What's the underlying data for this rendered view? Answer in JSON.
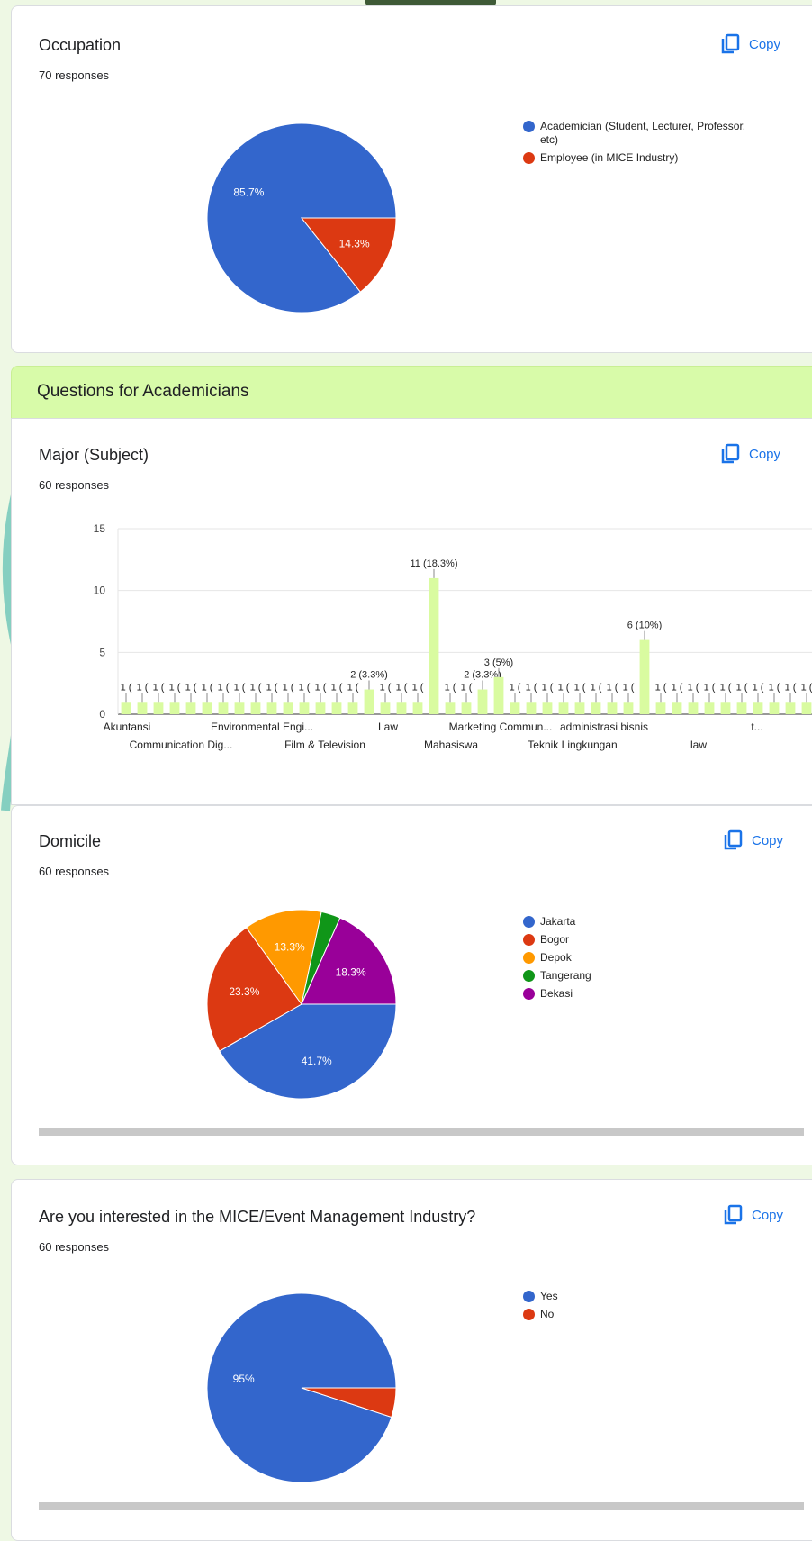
{
  "colors": {
    "blue": "#3366cc",
    "red": "#dc3912",
    "orange": "#ff9900",
    "green": "#109618",
    "purple": "#990099",
    "bar": "#d9fba0",
    "accent_link": "#1a73e8",
    "section_bg": "#d8fba9"
  },
  "copy_label": "Copy",
  "section": {
    "title": "Questions for Academicians"
  },
  "cards": {
    "occupation": {
      "title": "Occupation",
      "responses": "70 responses",
      "legend": [
        "Academician (Student, Lecturer, Professor, etc)",
        "Employee (in MICE Industry)"
      ]
    },
    "major": {
      "title": "Major (Subject)",
      "responses": "60 responses"
    },
    "domicile": {
      "title": "Domicile",
      "responses": "60 responses",
      "legend": [
        "Jakarta",
        "Bogor",
        "Depok",
        "Tangerang",
        "Bekasi"
      ]
    },
    "interest": {
      "title": "Are you interested in the MICE/Event Management Industry?",
      "responses": "60 responses",
      "legend": [
        "Yes",
        "No"
      ]
    }
  },
  "chart_data": [
    {
      "type": "pie",
      "categories": [
        "Academician (Student, Lecturer, Professor, etc)",
        "Employee (in MICE Industry)"
      ],
      "values": [
        85.7,
        14.3
      ],
      "labels": [
        "85.7%",
        "14.3%"
      ],
      "colors": [
        "#3366cc",
        "#dc3912"
      ],
      "legend_position": "right"
    },
    {
      "type": "bar",
      "ylim": [
        0,
        15
      ],
      "yticks": [
        0,
        5,
        10,
        15
      ],
      "x_tick_labels_row1": [
        "Akuntansi",
        "Environmental Engi...",
        "Law",
        "Marketing Commun...",
        "administrasi bisnis",
        "t..."
      ],
      "x_tick_labels_row2": [
        "Communication Dig...",
        "Film & Television",
        "Mahasiswa",
        "Teknik Lingkungan",
        "law"
      ],
      "values": [
        1,
        1,
        1,
        1,
        1,
        1,
        1,
        1,
        1,
        1,
        1,
        1,
        1,
        1,
        1,
        2,
        1,
        1,
        1,
        11,
        1,
        1,
        2,
        3,
        1,
        1,
        1,
        1,
        1,
        1,
        1,
        1,
        6,
        1,
        1,
        1,
        1,
        1,
        1,
        1,
        1,
        1,
        1
      ],
      "data_labels": {
        "11": "11 (18.3%)",
        "6": "6 (10%)",
        "3": "3 (5%)",
        "2": "2 (3.3%)",
        "1": "1 ("
      },
      "grid": true
    },
    {
      "type": "pie",
      "categories": [
        "Jakarta",
        "Bogor",
        "Depok",
        "Tangerang",
        "Bekasi"
      ],
      "values": [
        41.7,
        23.3,
        13.3,
        3.3,
        18.3
      ],
      "labels": [
        "41.7%",
        "23.3%",
        "13.3%",
        "",
        "18.3%"
      ],
      "colors": [
        "#3366cc",
        "#dc3912",
        "#ff9900",
        "#109618",
        "#990099"
      ],
      "legend_position": "right"
    },
    {
      "type": "pie",
      "categories": [
        "Yes",
        "No"
      ],
      "values": [
        95,
        5
      ],
      "labels": [
        "95%",
        ""
      ],
      "colors": [
        "#3366cc",
        "#dc3912"
      ],
      "legend_position": "right"
    }
  ]
}
